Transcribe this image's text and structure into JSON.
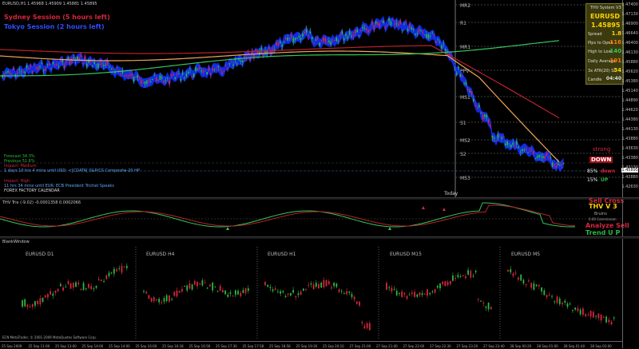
{
  "main_chart": {
    "header": "EURUSD,H1  1.45968 1.45909 1.45881 1.45895",
    "sydney_session": "Sydney Session (5 hours left)",
    "tokyo_session": "Tokyo Session (2 hours left)",
    "forecast": "Forecast  34.3%",
    "previous": "Previous  51.6%",
    "news_line_1": "1 days 10 hrs 4 mins until USD: <[CDATA[ S&P/CS Composite-20 HP",
    "impact_medium": "Impact: Medium",
    "impact_high": "Impact: High",
    "news_line_2": "11 hrs 34 mins until EUR: ECB President Trichet Speaks",
    "calendar": "FOREX FACTORY CALENDAR",
    "today_label": "Today",
    "signal_strong": "strong",
    "signal_down": "DOWN",
    "pct_85": "85%",
    "pct_85_word": "down",
    "pct_15": "15%",
    "pct_15_word": "UP",
    "pivots": [
      {
        "name": "MR2",
        "color": "#888888"
      },
      {
        "name": "R1",
        "color": "#888888"
      },
      {
        "name": "MR1",
        "color": "#888888"
      },
      {
        "name": "PPV",
        "color": "#888888"
      },
      {
        "name": "MS1",
        "color": "#888888"
      },
      {
        "name": "S1",
        "color": "#888888"
      },
      {
        "name": "MS2",
        "color": "#888888"
      },
      {
        "name": "S2",
        "color": "#888888"
      },
      {
        "name": "MS3",
        "color": "#888888"
      }
    ],
    "price_axis": [
      "1.47400",
      "1.47130",
      "1.46900",
      "1.46640",
      "1.46400",
      "1.46130",
      "1.45880",
      "1.45620",
      "1.45380",
      "1.45140",
      "1.44890",
      "1.44620",
      "1.44380",
      "1.44130",
      "1.43880",
      "1.43630",
      "1.43380",
      "1.43130",
      "1.42880",
      "1.42630",
      "1.45895"
    ]
  },
  "info_panel": {
    "title": "THV System V3",
    "symbol": "EURUSD",
    "price": "1.45895",
    "spread_label": "Spread",
    "spread_value": "1.8",
    "pips_open_label": "Pips to Open",
    "pips_open_value": "-116",
    "high_low_label": "High to Low",
    "high_low_value": "140",
    "daily_avg_label": "Daily Average",
    "daily_avg_value": "101",
    "atr_label": "3x ATR(20) SL",
    "atr_value": "34",
    "candle_label": "Candle",
    "candle_value": "04:40"
  },
  "indicator_pane": {
    "header": "THV Trix (-9.02)  -0.0001358  0.0002066",
    "sell_label": "Sell Cross",
    "thv_label": "THV V 3",
    "sub_label": "Bruins",
    "sub_label_2": "0.00 Commission",
    "analyze_label": "Analyze Sell",
    "trend_label": "Trend U P"
  },
  "mtf_pane": {
    "header": "BlankWindow",
    "timeframes": [
      "EURUSD  D1",
      "EURUSD  H4",
      "EURUSD  H1",
      "EURUSD  M15",
      "EURUSD  M5"
    ],
    "copyright": "ECN MetaTrader, © 2001-2009 MetaQuotes Software Corp.",
    "x_axis": [
      "25 Sep 2009",
      "25 Sep 11:00",
      "25 Sep 13:00",
      "25 Sep 14:00",
      "25 Sep 14:00",
      "25 Sep 16:00",
      "25 Sep 16:18",
      "25 Sep 16:58",
      "25 Sep 17:30",
      "25 Sep 17:58",
      "25 Sep 18:58",
      "25 Sep 19:30",
      "25 Sep 20:10",
      "27 Sep 21:00",
      "27 Sep 21:40",
      "27 Sep 22:00",
      "27 Sep 22:30",
      "27 Sep 23:20",
      "27 Sep 23:40",
      "28 Sep 00:20",
      "28 Sep 01:00",
      "28 Sep 01:40",
      "28 Sep 02:00"
    ]
  },
  "colors": {
    "bull": "#2db83d",
    "bear": "#d7263d",
    "blue_band": "#1030ff",
    "orange_ma": "#f2a65a",
    "red_ma": "#b8232b",
    "green_ma": "#34c759",
    "info_bg": "#3b3b0f",
    "yellow": "#ffd200"
  }
}
